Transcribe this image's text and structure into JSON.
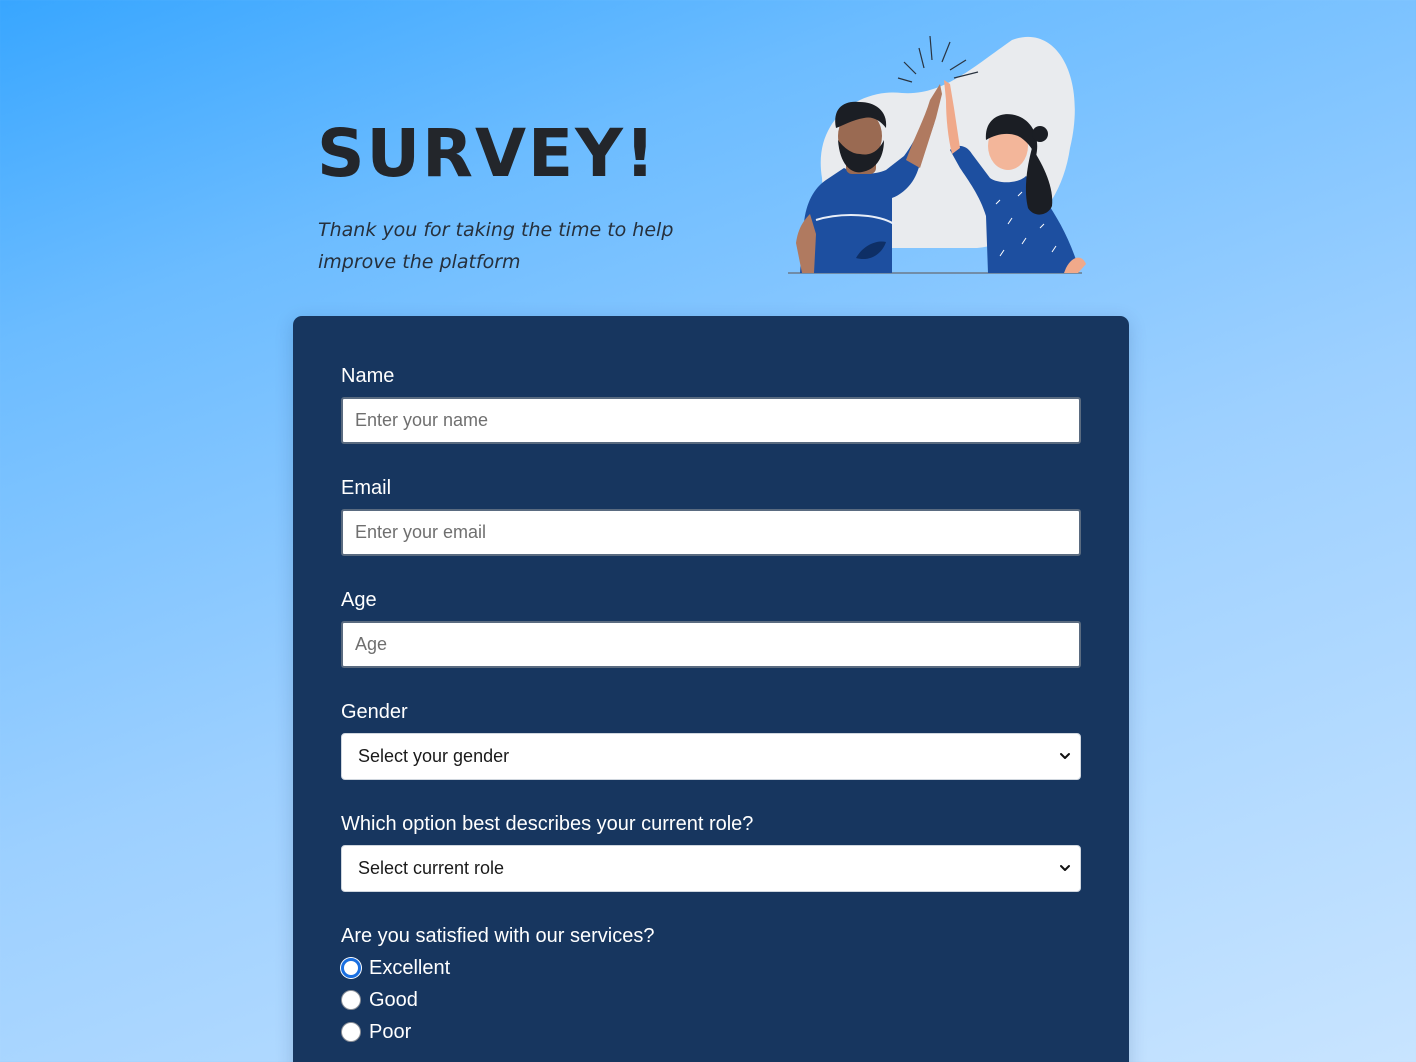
{
  "hero": {
    "title": "SURVEY!",
    "subtitle": "Thank you for taking the time to help improve the platform"
  },
  "form": {
    "name": {
      "label": "Name",
      "placeholder": "Enter your name",
      "value": ""
    },
    "email": {
      "label": "Email",
      "placeholder": "Enter your email",
      "value": ""
    },
    "age": {
      "label": "Age",
      "placeholder": "Age",
      "value": ""
    },
    "gender": {
      "label": "Gender",
      "selected": "Select your gender"
    },
    "role": {
      "label": "Which option best describes your current role?",
      "selected": "Select current role"
    },
    "satisfaction": {
      "label": "Are you satisfied with our services?",
      "options": [
        {
          "label": "Excellent",
          "checked": true
        },
        {
          "label": "Good",
          "checked": false
        },
        {
          "label": "Poor",
          "checked": false
        }
      ]
    }
  },
  "colors": {
    "card": "#17365f",
    "radio_accent": "#1a6fe0",
    "title": "#23262b"
  },
  "icons": {
    "illustration": "two-people-high-five-illustration",
    "select_arrow": "chevron-down-icon"
  }
}
